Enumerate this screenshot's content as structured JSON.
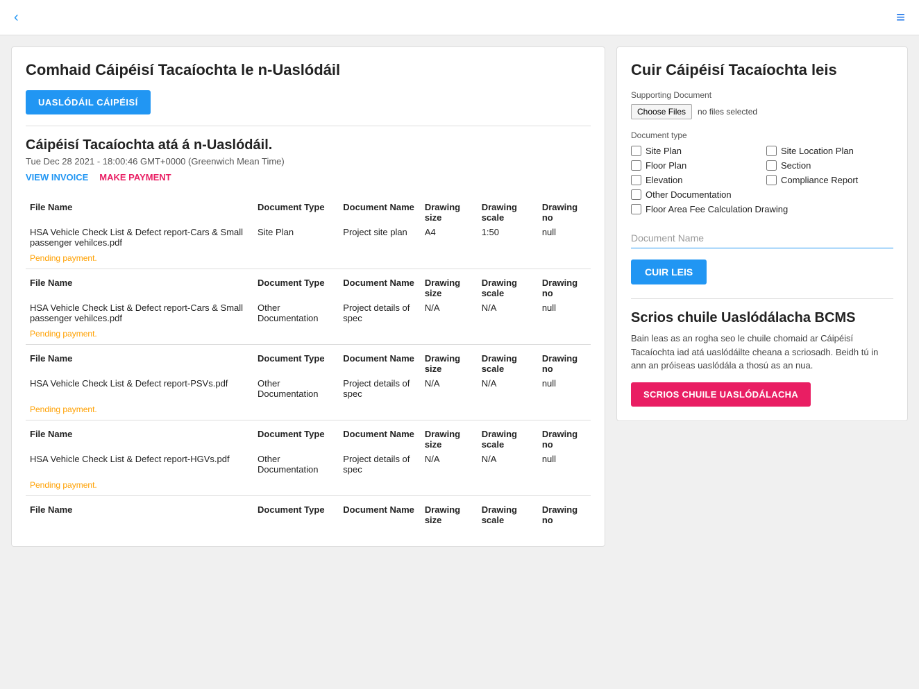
{
  "topbar": {
    "back_label": "‹",
    "menu_icon": "≡"
  },
  "left": {
    "main_title": "Comhaid Cáipéisí Tacaíochta le n-Uaslódáil",
    "upload_btn": "UASLÓDÁIL CÁIPÉISÍ",
    "section_title": "Cáipéisí Tacaíochta atá á n-Uaslódáil.",
    "section_date": "Tue Dec 28 2021 - 18:00:46 GMT+0000 (Greenwich Mean Time)",
    "view_invoice": "VIEW INVOICE",
    "make_payment": "MAKE PAYMENT",
    "col_headers": [
      "File Name",
      "Document Type",
      "Document Name",
      "Drawing size",
      "Drawing scale",
      "Drawing no"
    ],
    "documents": [
      {
        "filename": "HSA Vehicle Check List & Defect report-Cars & Small passenger vehilces.pdf",
        "doctype": "Site Plan",
        "docname": "Project site plan",
        "drawsize": "A4",
        "drawscale": "1:50",
        "drawno": "null",
        "pending": "Pending payment."
      },
      {
        "filename": "HSA Vehicle Check List & Defect report-Cars & Small passenger vehilces.pdf",
        "doctype": "Other Documentation",
        "docname": "Project details of spec",
        "drawsize": "N/A",
        "drawscale": "N/A",
        "drawno": "null",
        "pending": "Pending payment."
      },
      {
        "filename": "HSA Vehicle Check List & Defect report-PSVs.pdf",
        "doctype": "Other Documentation",
        "docname": "Project details of spec",
        "drawsize": "N/A",
        "drawscale": "N/A",
        "drawno": "null",
        "pending": "Pending payment."
      },
      {
        "filename": "HSA Vehicle Check List & Defect report-HGVs.pdf",
        "doctype": "Other Documentation",
        "docname": "Project details of spec",
        "drawsize": "N/A",
        "drawscale": "N/A",
        "drawno": "null",
        "pending": "Pending payment."
      },
      {
        "filename": "",
        "doctype": "",
        "docname": "",
        "drawsize": "",
        "drawscale": "",
        "drawno": "",
        "pending": ""
      }
    ]
  },
  "right": {
    "title": "Cuir Cáipéisí Tacaíochta leis",
    "supporting_doc_label": "Supporting Document",
    "choose_files_btn": "Choose Files",
    "no_files_text": "no files selected",
    "doc_type_label": "Document type",
    "checkboxes": [
      {
        "id": "cb_site_plan",
        "label": "Site Plan"
      },
      {
        "id": "cb_site_location",
        "label": "Site Location Plan"
      },
      {
        "id": "cb_floor_plan",
        "label": "Floor Plan"
      },
      {
        "id": "cb_section",
        "label": "Section"
      },
      {
        "id": "cb_elevation",
        "label": "Elevation"
      },
      {
        "id": "cb_compliance",
        "label": "Compliance Report"
      },
      {
        "id": "cb_other_doc",
        "label": "Other Documentation"
      },
      {
        "id": "cb_floor_area",
        "label": "Floor Area Fee Calculation Drawing",
        "full": true
      }
    ],
    "doc_name_placeholder": "Document Name",
    "cuir_btn": "CUIR LEIS",
    "delete_title": "Scrios chuile Uaslódálacha BCMS",
    "delete_desc": "Bain leas as an rogha seo le chuile chomaid ar Cáipéisí Tacaíochta iad atá uaslódáilte cheana a scriosadh. Beidh tú in ann an próiseas uaslódála a thosú as an nua.",
    "delete_btn": "SCRIOS CHUILE UASLÓDÁLACHA"
  }
}
